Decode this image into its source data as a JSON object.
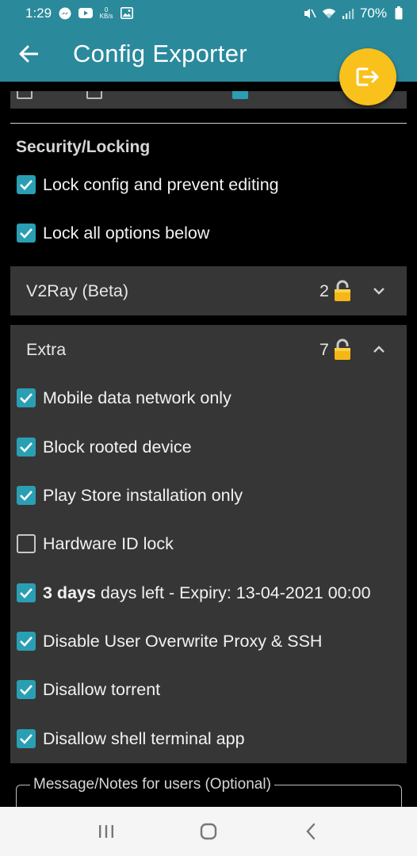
{
  "status_bar": {
    "time": "1:29",
    "speed_value": "0",
    "speed_unit": "KB/s",
    "battery": "70%"
  },
  "app_bar": {
    "title": "Config Exporter"
  },
  "security": {
    "title": "Security/Locking",
    "lock_config": {
      "label": "Lock config and prevent editing",
      "checked": true
    },
    "lock_all": {
      "label": "Lock all options below",
      "checked": true
    }
  },
  "v2ray_panel": {
    "title": "V2Ray (Beta)",
    "count": "2",
    "expanded": false
  },
  "extra_panel": {
    "title": "Extra",
    "count": "7",
    "expanded": true,
    "items": [
      {
        "label": "Mobile data network only",
        "checked": true
      },
      {
        "label": "Block rooted device",
        "checked": true
      },
      {
        "label": "Play Store installation only",
        "checked": true
      },
      {
        "label": "Hardware ID lock",
        "checked": false
      },
      {
        "bold": "3 days",
        "label": "days left - Expiry: 13-04-2021 00:00",
        "checked": true
      },
      {
        "label": "Disable User Overwrite Proxy & SSH",
        "checked": true
      },
      {
        "label": "Disallow torrent",
        "checked": true
      },
      {
        "label": "Disallow shell terminal app",
        "checked": true
      }
    ]
  },
  "message": {
    "label": "Message/Notes for users (Optional)"
  },
  "colors": {
    "primary": "#2a8a9c",
    "accent": "#f9c11c",
    "checkbox": "#2a9fb3",
    "panel": "#363636"
  }
}
